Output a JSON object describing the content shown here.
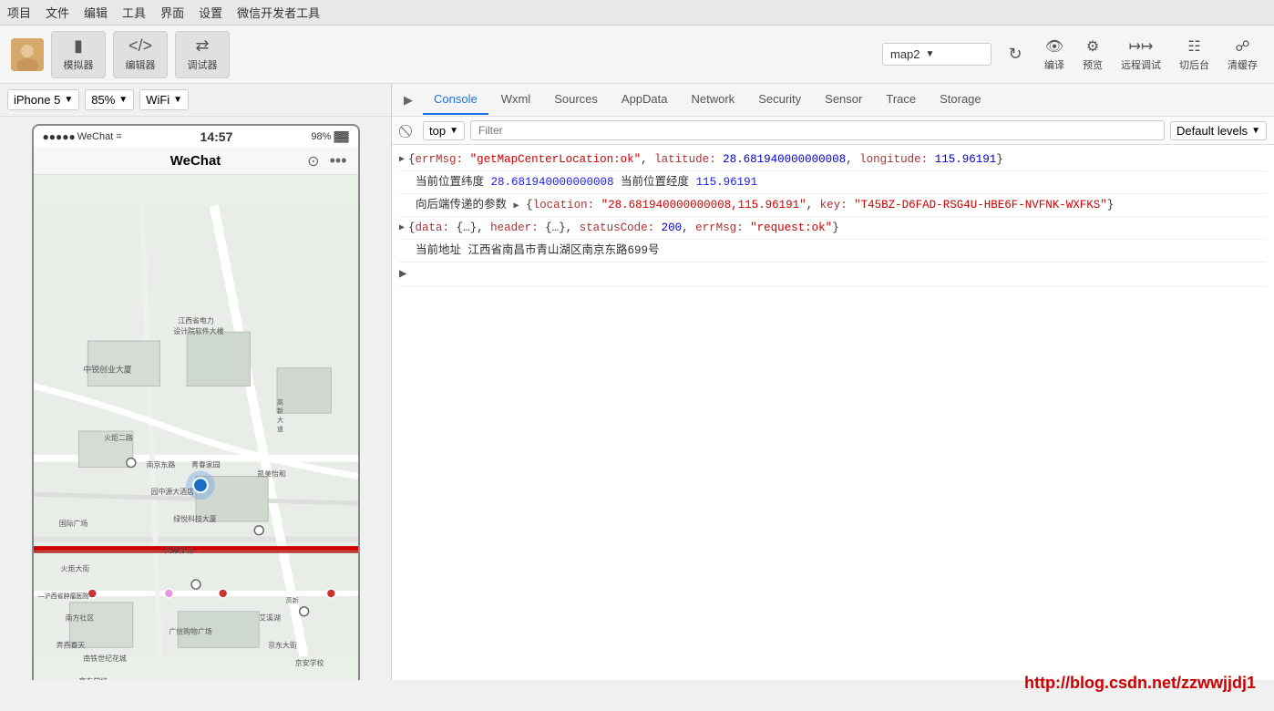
{
  "menubar": {
    "items": [
      "项目",
      "文件",
      "编辑",
      "工具",
      "界面",
      "设置",
      "微信开发者工具"
    ]
  },
  "toolbar": {
    "simulator_label": "模拟器",
    "editor_label": "编辑器",
    "debugger_label": "调试器",
    "project_name": "map2",
    "compile_label": "编译",
    "preview_label": "预览",
    "remote_debug_label": "远程调试",
    "cut_back_label": "切后台",
    "clear_cache_label": "清缓存"
  },
  "device_panel": {
    "device_name": "iPhone 5",
    "zoom_level": "85%",
    "network": "WiFi",
    "phone": {
      "signal": "●●●●●",
      "carrier": "WeChat",
      "time": "14:57",
      "battery": "98%",
      "title": "WeChat"
    }
  },
  "devtools": {
    "tabs": [
      "Console",
      "Wxml",
      "Sources",
      "AppData",
      "Network",
      "Security",
      "Sensor",
      "Trace",
      "Storage"
    ],
    "active_tab": "Console",
    "context": "top",
    "filter_placeholder": "Filter",
    "level": "Default levels",
    "console_lines": [
      {
        "id": 1,
        "expandable": true,
        "content": "{errMsg: \"getMapCenterLocation:ok\", latitude: 28.681940000000008, longitude: 115.96191}"
      },
      {
        "id": 2,
        "expandable": false,
        "prefix": "当前位置纬度",
        "value1": "28.681940000000008",
        "middle": "当前位置经度",
        "value2": "115.96191"
      },
      {
        "id": 3,
        "expandable": true,
        "prefix": "向后端传递的参数",
        "content": "{location: \"28.681940000000008,115.96191\", key: \"T45BZ-D6FAD-RSG4U-HBE6F-NVFNK-WXFKS\"}"
      },
      {
        "id": 4,
        "expandable": true,
        "content": "{data: {…}, header: {…}, statusCode: 200, errMsg: \"request:ok\"}"
      },
      {
        "id": 5,
        "expandable": false,
        "prefix": "当前地址",
        "value": "江西省南昌市青山湖区南京东路699号"
      }
    ]
  },
  "watermark": "http://blog.csdn.net/zzwwjjdj1"
}
